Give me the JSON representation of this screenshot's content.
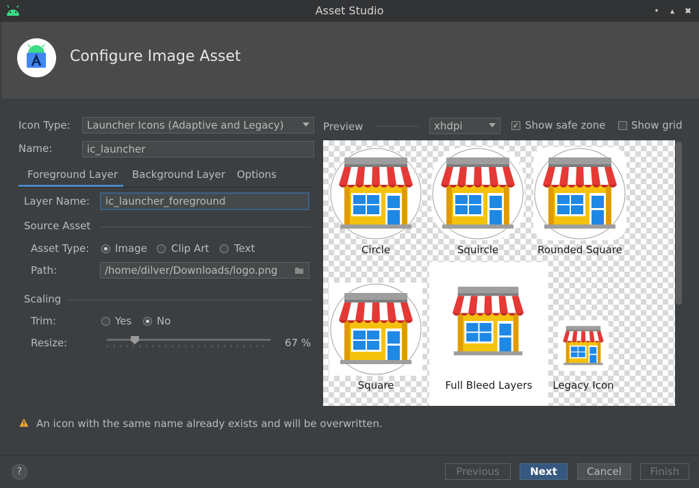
{
  "window": {
    "title": "Asset Studio",
    "minimize_glyph": "•",
    "maximize_glyph": "▴",
    "close_glyph": "✖"
  },
  "header": {
    "title": "Configure Image Asset"
  },
  "form": {
    "icon_type_label": "Icon Type:",
    "icon_type_value": "Launcher Icons (Adaptive and Legacy)",
    "name_label": "Name:",
    "name_value": "ic_launcher",
    "tabs": [
      {
        "label": "Foreground Layer",
        "selected": true
      },
      {
        "label": "Background Layer",
        "selected": false
      },
      {
        "label": "Options",
        "selected": false
      }
    ],
    "layer_name_label": "Layer Name:",
    "layer_name_value": "ic_launcher_foreground",
    "source_asset_title": "Source Asset",
    "asset_type_label": "Asset Type:",
    "asset_type_options": [
      {
        "label": "Image",
        "checked": true
      },
      {
        "label": "Clip Art",
        "checked": false
      },
      {
        "label": "Text",
        "checked": false
      }
    ],
    "path_label": "Path:",
    "path_value": "/home/dilver/Downloads/logo.png",
    "scaling_title": "Scaling",
    "trim_label": "Trim:",
    "trim_options": [
      {
        "label": "Yes",
        "checked": false
      },
      {
        "label": "No",
        "checked": true
      }
    ],
    "resize_label": "Resize:",
    "resize_value": 67,
    "resize_text": "67 %"
  },
  "preview": {
    "label": "Preview",
    "density_value": "xhdpi",
    "show_safe_zone_label": "Show safe zone",
    "show_safe_zone_checked": true,
    "show_grid_label": "Show grid",
    "show_grid_checked": false,
    "icons": [
      {
        "label": "Circle"
      },
      {
        "label": "Squircle"
      },
      {
        "label": "Rounded Square"
      },
      {
        "label": "Square"
      },
      {
        "label": "Full Bleed Layers"
      },
      {
        "label": "Legacy Icon"
      }
    ]
  },
  "warning": {
    "text": "An icon with the same name already exists and will be overwritten."
  },
  "footer": {
    "help_label": "?",
    "previous_label": "Previous",
    "next_label": "Next",
    "cancel_label": "Cancel",
    "finish_label": "Finish"
  },
  "colors": {
    "accent": "#4a88c7",
    "primary_button": "#365880",
    "warning": "#f0a732"
  }
}
